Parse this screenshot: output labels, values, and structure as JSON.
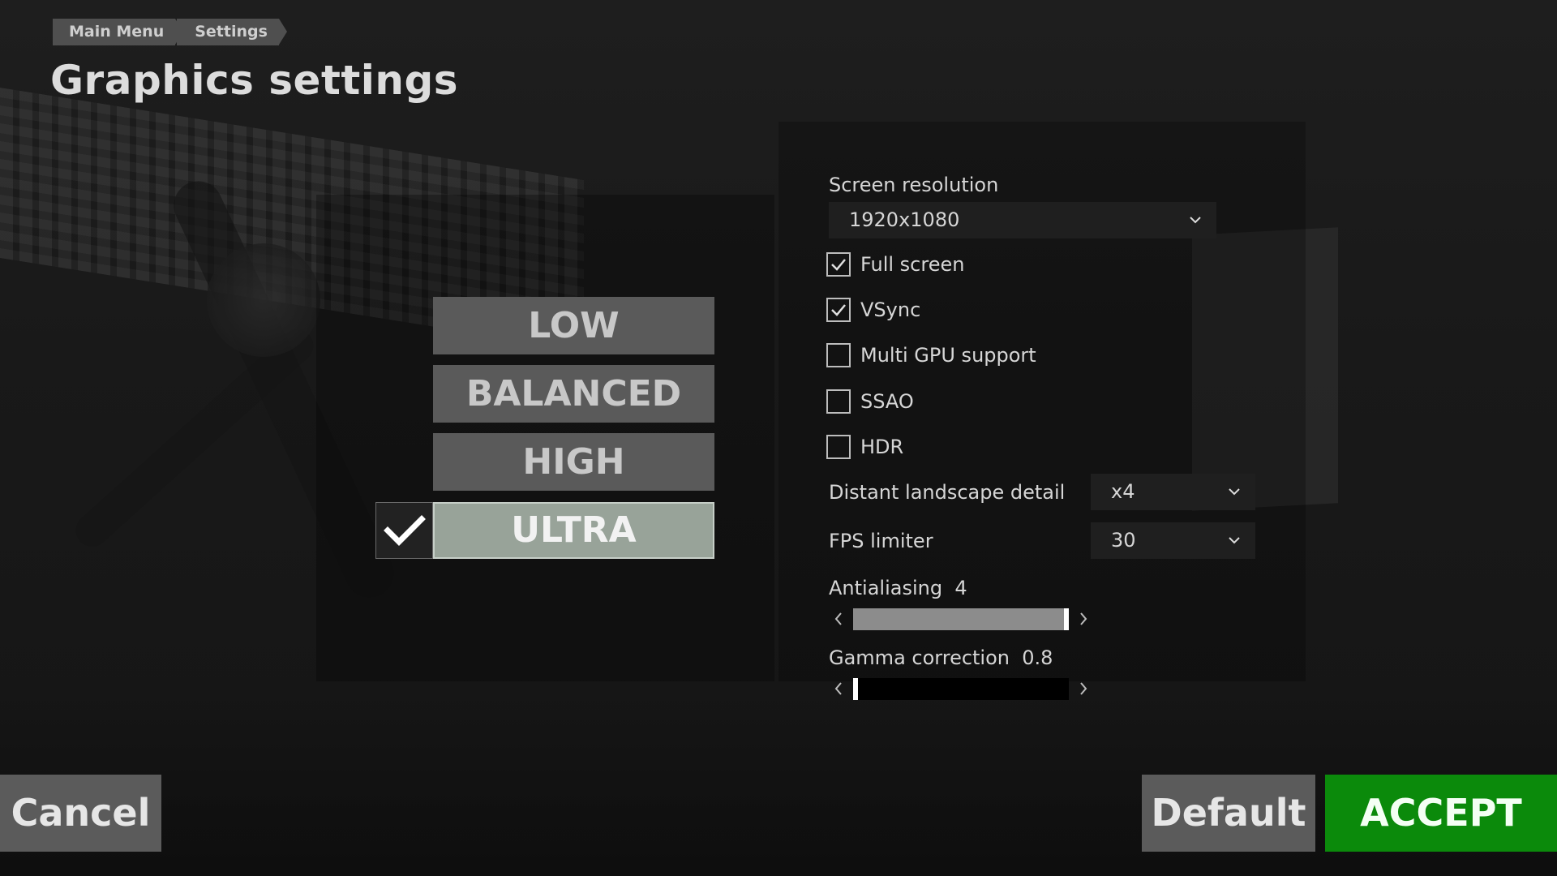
{
  "breadcrumb": [
    "Main Menu",
    "Settings"
  ],
  "page_title": "Graphics settings",
  "presets": {
    "items": [
      "LOW",
      "BALANCED",
      "HIGH",
      "ULTRA"
    ],
    "selected": "ULTRA"
  },
  "settings": {
    "screen_resolution": {
      "label": "Screen resolution",
      "value": "1920x1080"
    },
    "checkboxes": [
      {
        "label": "Full screen",
        "checked": true
      },
      {
        "label": "VSync",
        "checked": true
      },
      {
        "label": "Multi GPU support",
        "checked": false
      },
      {
        "label": "SSAO",
        "checked": false
      },
      {
        "label": "HDR",
        "checked": false
      }
    ],
    "distant_landscape_detail": {
      "label": "Distant landscape detail",
      "value": "x4"
    },
    "fps_limiter": {
      "label": "FPS limiter",
      "value": "30"
    },
    "antialiasing": {
      "label": "Antialiasing",
      "value": "4",
      "level": 1.0
    },
    "gamma_correction": {
      "label": "Gamma correction",
      "value": "0.8",
      "level": 0.0
    }
  },
  "buttons": {
    "cancel": "Cancel",
    "default": "Default",
    "accept": "ACCEPT"
  },
  "colors": {
    "accept_green": "#0b8a0b",
    "selected_preset": "#98a399"
  },
  "icons": {
    "preset_check": "checkmark-icon",
    "dropdown": "chevron-down-icon",
    "slider_left": "chevron-left-icon",
    "slider_right": "chevron-right-icon"
  }
}
